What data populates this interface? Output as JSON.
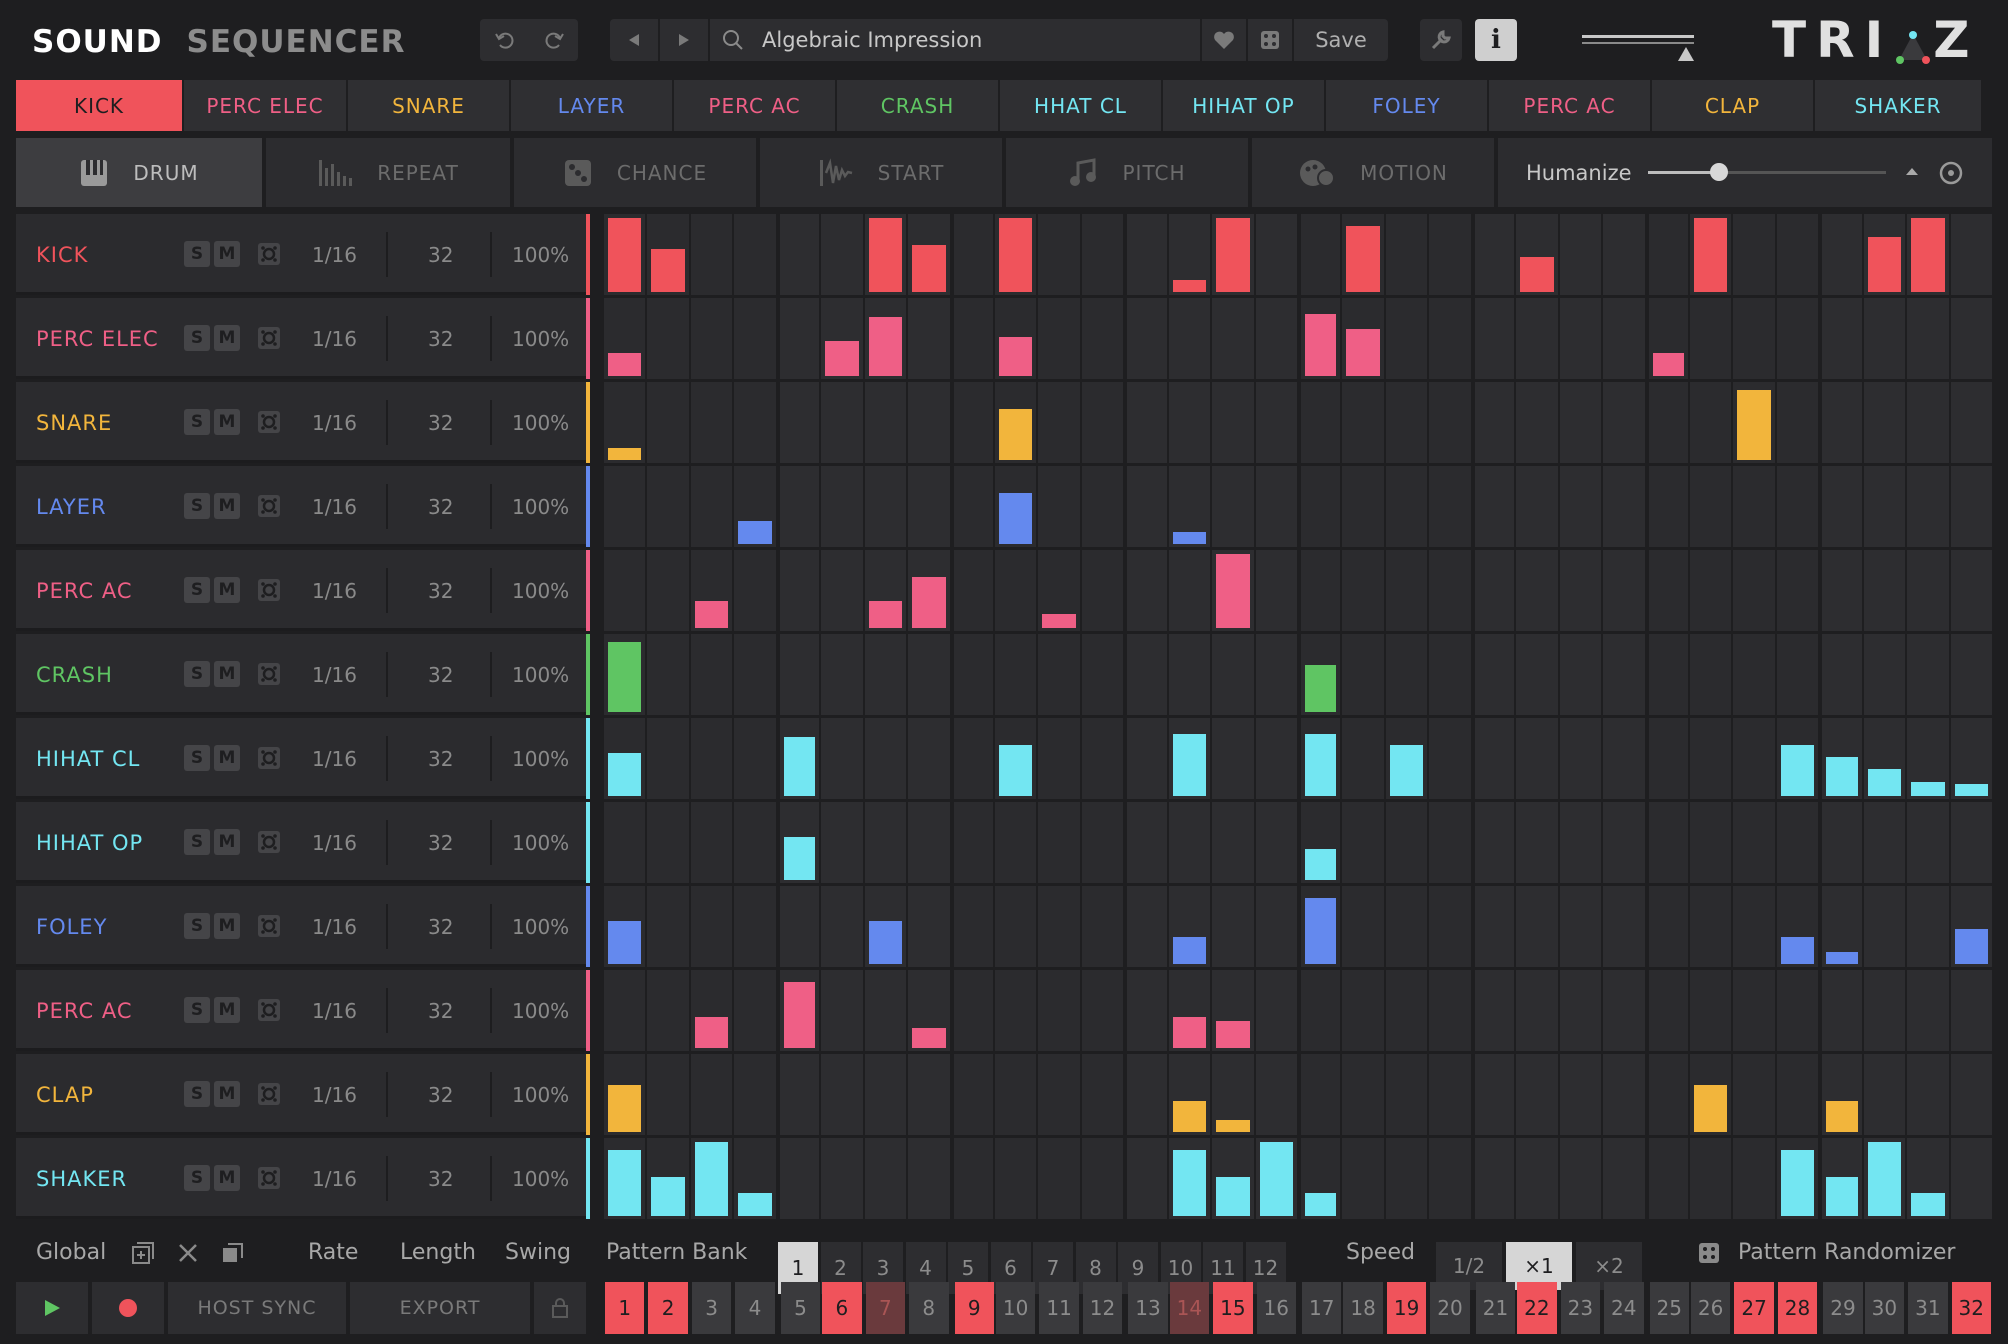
{
  "header": {
    "title_part1": "SOUND",
    "title_part2": "SEQUENCER",
    "preset_name": "Algebraic Impression",
    "save_label": "Save",
    "logo": "TRIAZ"
  },
  "colors": {
    "red": "#f0535b",
    "pink": "#ef5f86",
    "yellow": "#f2b53c",
    "blue": "#6489ee",
    "green": "#5fc563",
    "cyan": "#73e6f2"
  },
  "tabs": [
    {
      "label": "KICK",
      "color": "#f0535b",
      "active": true
    },
    {
      "label": "PERC ELEC",
      "color": "#ef5f86"
    },
    {
      "label": "SNARE",
      "color": "#f2b53c"
    },
    {
      "label": "LAYER",
      "color": "#6489ee"
    },
    {
      "label": "PERC AC",
      "color": "#ef5f86"
    },
    {
      "label": "CRASH",
      "color": "#5fc563"
    },
    {
      "label": "HHAT CL",
      "color": "#73e6f2"
    },
    {
      "label": "HIHAT OP",
      "color": "#73e6f2"
    },
    {
      "label": "FOLEY",
      "color": "#6489ee"
    },
    {
      "label": "PERC AC",
      "color": "#ef5f86"
    },
    {
      "label": "CLAP",
      "color": "#f2b53c"
    },
    {
      "label": "SHAKER",
      "color": "#73e6f2"
    }
  ],
  "modes": [
    {
      "label": "DRUM",
      "icon": "piano-keys-icon",
      "active": true
    },
    {
      "label": "REPEAT",
      "icon": "repeat-bars-icon"
    },
    {
      "label": "CHANCE",
      "icon": "dice-icon"
    },
    {
      "label": "START",
      "icon": "waveform-icon"
    },
    {
      "label": "PITCH",
      "icon": "music-note-icon"
    },
    {
      "label": "MOTION",
      "icon": "motion-icon"
    }
  ],
  "humanize": {
    "label": "Humanize",
    "value": 0.3
  },
  "tracks": [
    {
      "name": "KICK",
      "color": "#f0535b",
      "rate": "1/16",
      "length": "32",
      "swing": "100%",
      "steps": [
        0.95,
        0.55,
        0,
        0,
        0,
        0,
        0.95,
        0.6,
        0,
        0.95,
        0,
        0,
        0,
        0.15,
        0.95,
        0,
        0,
        0.85,
        0,
        0,
        0,
        0.45,
        0,
        0,
        0,
        0.95,
        0,
        0,
        0,
        0.7,
        0.95,
        0,
        0,
        0,
        0,
        0.95
      ]
    },
    {
      "name": "PERC ELEC",
      "color": "#ef5f86",
      "rate": "1/16",
      "length": "32",
      "swing": "100%",
      "steps": [
        0.3,
        0,
        0,
        0,
        0,
        0.45,
        0.75,
        0,
        0,
        0.5,
        0,
        0,
        0,
        0,
        0,
        0,
        0.8,
        0.6,
        0,
        0,
        0,
        0,
        0,
        0,
        0.3,
        0,
        0,
        0,
        0,
        0,
        0,
        0,
        0
      ]
    },
    {
      "name": "SNARE",
      "color": "#f2b53c",
      "rate": "1/16",
      "length": "32",
      "swing": "100%",
      "steps": [
        0.15,
        0,
        0,
        0,
        0,
        0,
        0,
        0,
        0,
        0.65,
        0,
        0,
        0,
        0,
        0,
        0,
        0,
        0,
        0,
        0,
        0,
        0,
        0,
        0,
        0,
        0,
        0.9,
        0,
        0,
        0,
        0,
        0
      ]
    },
    {
      "name": "LAYER",
      "color": "#6489ee",
      "rate": "1/16",
      "length": "32",
      "swing": "100%",
      "steps": [
        0,
        0,
        0,
        0.3,
        0,
        0,
        0,
        0,
        0,
        0.65,
        0,
        0,
        0,
        0.15,
        0,
        0,
        0,
        0,
        0,
        0,
        0,
        0,
        0,
        0,
        0,
        0,
        0,
        0,
        0,
        0,
        0,
        0
      ]
    },
    {
      "name": "PERC AC",
      "color": "#ef5f86",
      "rate": "1/16",
      "length": "32",
      "swing": "100%",
      "steps": [
        0,
        0,
        0.35,
        0,
        0,
        0,
        0.35,
        0.65,
        0,
        0,
        0.18,
        0,
        0,
        0,
        0.95,
        0,
        0,
        0,
        0,
        0,
        0,
        0,
        0,
        0,
        0,
        0,
        0,
        0,
        0,
        0,
        0,
        0
      ]
    },
    {
      "name": "CRASH",
      "color": "#5fc563",
      "rate": "1/16",
      "length": "32",
      "swing": "100%",
      "steps": [
        0.9,
        0,
        0,
        0,
        0,
        0,
        0,
        0,
        0,
        0,
        0,
        0,
        0,
        0,
        0,
        0,
        0.6,
        0,
        0,
        0,
        0,
        0,
        0,
        0,
        0,
        0,
        0,
        0,
        0,
        0,
        0,
        0
      ]
    },
    {
      "name": "HIHAT CL",
      "color": "#73e6f2",
      "rate": "1/16",
      "length": "32",
      "swing": "100%",
      "steps": [
        0.55,
        0,
        0,
        0,
        0.75,
        0,
        0,
        0,
        0,
        0.65,
        0,
        0,
        0,
        0.8,
        0,
        0,
        0.8,
        0,
        0.65,
        0,
        0,
        0,
        0,
        0,
        0,
        0,
        0,
        0.65,
        0.5,
        0.35,
        0.18,
        0.15,
        0.05
      ]
    },
    {
      "name": "HIHAT OP",
      "color": "#73e6f2",
      "rate": "1/16",
      "length": "32",
      "swing": "100%",
      "steps": [
        0,
        0,
        0,
        0,
        0.55,
        0,
        0,
        0,
        0,
        0,
        0,
        0,
        0,
        0,
        0,
        0,
        0.4,
        0,
        0,
        0,
        0,
        0,
        0,
        0,
        0,
        0,
        0,
        0,
        0,
        0,
        0,
        0
      ]
    },
    {
      "name": "FOLEY",
      "color": "#6489ee",
      "rate": "1/16",
      "length": "32",
      "swing": "100%",
      "steps": [
        0.55,
        0,
        0,
        0,
        0,
        0,
        0.55,
        0,
        0,
        0,
        0,
        0,
        0,
        0.35,
        0,
        0,
        0.85,
        0,
        0,
        0,
        0,
        0,
        0,
        0,
        0,
        0,
        0,
        0.35,
        0.15,
        0,
        0,
        0.45,
        0
      ]
    },
    {
      "name": "PERC AC",
      "color": "#ef5f86",
      "rate": "1/16",
      "length": "32",
      "swing": "100%",
      "steps": [
        0,
        0,
        0.4,
        0,
        0.85,
        0,
        0,
        0.25,
        0,
        0,
        0,
        0,
        0,
        0.4,
        0.35,
        0,
        0,
        0,
        0,
        0,
        0,
        0,
        0,
        0,
        0,
        0,
        0,
        0,
        0,
        0,
        0,
        0
      ]
    },
    {
      "name": "CLAP",
      "color": "#f2b53c",
      "rate": "1/16",
      "length": "32",
      "swing": "100%",
      "steps": [
        0.6,
        0,
        0,
        0,
        0,
        0,
        0,
        0,
        0,
        0,
        0,
        0,
        0,
        0.4,
        0.15,
        0,
        0,
        0,
        0,
        0,
        0,
        0,
        0,
        0,
        0,
        0.6,
        0,
        0,
        0.4,
        0,
        0,
        0,
        0
      ]
    },
    {
      "name": "SHAKER",
      "color": "#73e6f2",
      "rate": "1/16",
      "length": "32",
      "swing": "100%",
      "steps": [
        0.85,
        0.5,
        0.95,
        0.3,
        0,
        0,
        0,
        0,
        0,
        0,
        0,
        0,
        0,
        0.85,
        0.5,
        0.95,
        0.3,
        0,
        0,
        0,
        0,
        0,
        0,
        0,
        0,
        0,
        0,
        0.85,
        0.5,
        0.95,
        0.3,
        0
      ]
    }
  ],
  "footer": {
    "global_label": "Global",
    "rate_label": "Rate",
    "length_label": "Length",
    "swing_label": "Swing",
    "pattern_bank_label": "Pattern Bank",
    "speed_label": "Speed",
    "speed_options": [
      "1/2",
      "×1",
      "×2"
    ],
    "speed_selected": 1,
    "randomizer_label": "Pattern Randomizer",
    "host_sync_label": "HOST SYNC",
    "export_label": "EXPORT",
    "bank_numbers": [
      "1",
      "2",
      "3",
      "4",
      "5",
      "6",
      "7",
      "8",
      "9",
      "10",
      "11",
      "12"
    ],
    "bank_selected": 0,
    "step_numbers": [
      "1",
      "2",
      "3",
      "4",
      "5",
      "6",
      "7",
      "8",
      "9",
      "10",
      "11",
      "12",
      "13",
      "14",
      "15",
      "16",
      "17",
      "18",
      "19",
      "20",
      "21",
      "22",
      "23",
      "24",
      "25",
      "26",
      "27",
      "28",
      "29",
      "30",
      "31",
      "32"
    ],
    "step_on": [
      1,
      1,
      0,
      0,
      0,
      1,
      2,
      0,
      1,
      0,
      0,
      0,
      0,
      2,
      1,
      0,
      0,
      0,
      1,
      0,
      0,
      1,
      0,
      0,
      0,
      0,
      1,
      1,
      0,
      0,
      0,
      1
    ]
  }
}
